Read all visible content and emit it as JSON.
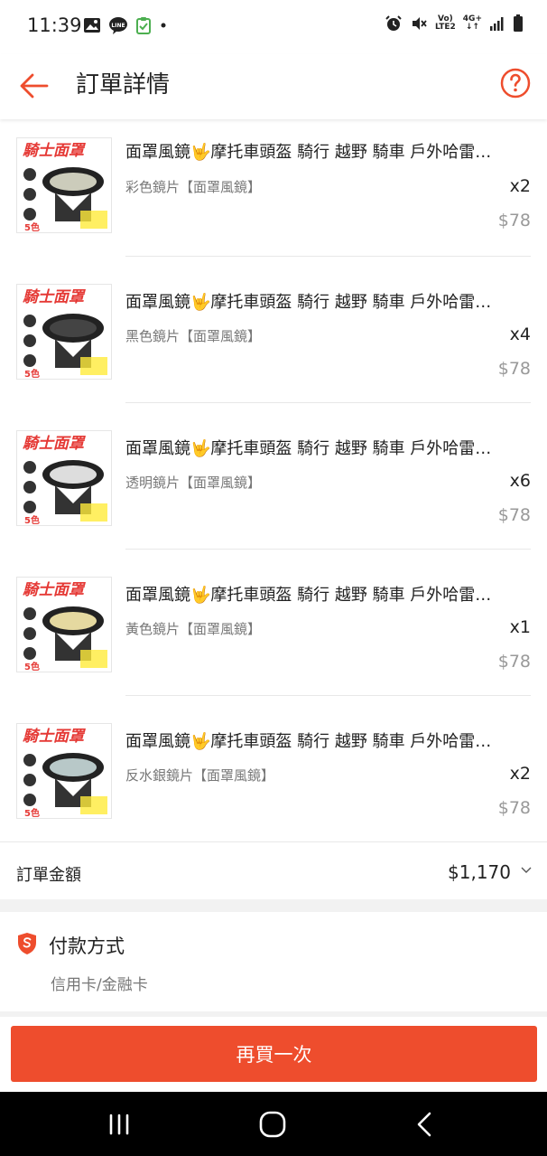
{
  "status_bar": {
    "time": "11:39",
    "left_icons": [
      "gallery-icon",
      "line-app-icon",
      "clipboard-check-icon",
      "dot-icon"
    ],
    "network_top": "Vo)",
    "network_bottom": "LTE2",
    "signal_top": "4G+"
  },
  "header": {
    "title": "訂單詳情",
    "back_icon": "back-arrow-icon",
    "help_icon": "help-icon"
  },
  "thumbnail_text": "騎士面罩",
  "items": [
    {
      "name": "面罩風鏡🤟摩托車頭盔 騎行 越野 騎車 戶外哈雷…",
      "variant": "彩色鏡片【面罩風鏡】",
      "qty": "x2",
      "price": "$78"
    },
    {
      "name": "面罩風鏡🤟摩托車頭盔 騎行 越野 騎車 戶外哈雷…",
      "variant": "黑色鏡片【面罩風鏡】",
      "qty": "x4",
      "price": "$78"
    },
    {
      "name": "面罩風鏡🤟摩托車頭盔 騎行 越野 騎車 戶外哈雷…",
      "variant": "透明鏡片【面罩風鏡】",
      "qty": "x6",
      "price": "$78"
    },
    {
      "name": "面罩風鏡🤟摩托車頭盔 騎行 越野 騎車 戶外哈雷…",
      "variant": "黃色鏡片【面罩風鏡】",
      "qty": "x1",
      "price": "$78"
    },
    {
      "name": "面罩風鏡🤟摩托車頭盔 騎行 越野 騎車 戶外哈雷…",
      "variant": "反水銀鏡片【面罩風鏡】",
      "qty": "x2",
      "price": "$78"
    }
  ],
  "order_total": {
    "label": "訂單金額",
    "value": "$1,170"
  },
  "payment": {
    "title": "付款方式",
    "method": "信用卡/金融卡"
  },
  "actions": {
    "buy_again": "再買一次"
  },
  "colors": {
    "accent": "#ee4d2d",
    "text": "#222222",
    "muted": "#777777",
    "price": "#999999"
  }
}
